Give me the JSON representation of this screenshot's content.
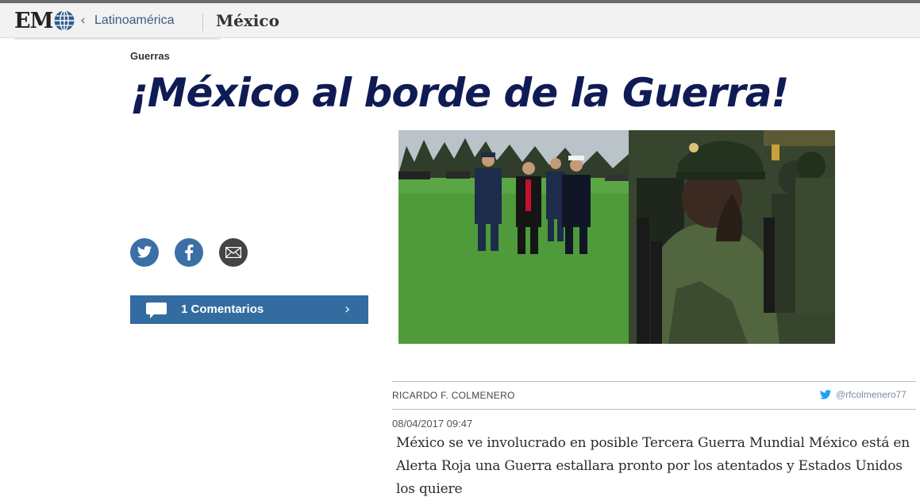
{
  "header": {
    "logo_text": "EM",
    "breadcrumb_chevron": "‹",
    "breadcrumb_link": "Latinoamérica",
    "section_title": "México"
  },
  "article": {
    "kicker": "Guerras",
    "headline": "¡México al borde de la Guerra!",
    "image_icon": "military-parade-photo",
    "share_icons": [
      "twitter-icon",
      "facebook-icon",
      "email-icon"
    ],
    "comments_label": "1 Comentarios",
    "comments_chevron": "›",
    "author": "RICARDO F. COLMENERO",
    "twitter_handle": "@rfcolmenero77",
    "date": "08/04/2017 09:47",
    "body": "México se ve involucrado en posible Tercera Guerra Mundial México está en Alerta Roja una Guerra estallara pronto por los atentados y Estados Unidos los quiere"
  },
  "colors": {
    "headline": "#0f1b55",
    "share_blue": "#3b6fa6",
    "comments_bar": "#346ba0",
    "twitter_bird": "#1da1f2"
  }
}
